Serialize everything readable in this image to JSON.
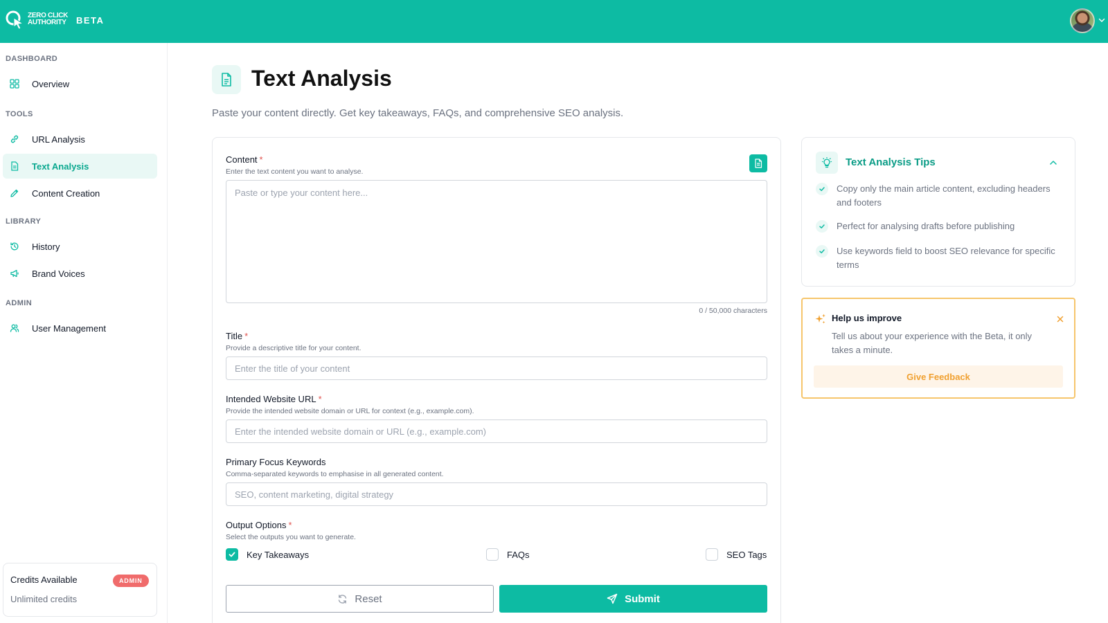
{
  "header": {
    "logo_text_line1": "ZERO CLICK",
    "logo_text_line2": "AUTHORITY",
    "beta_label": "BETA",
    "brand_color": "#0dbba3"
  },
  "sidebar": {
    "sections": {
      "dashboard": "DASHBOARD",
      "tools": "TOOLS",
      "library": "LIBRARY",
      "admin": "ADMIN"
    },
    "items": {
      "overview": "Overview",
      "url_analysis": "URL Analysis",
      "text_analysis": "Text Analysis",
      "content_creation": "Content Creation",
      "history": "History",
      "brand_voices": "Brand Voices",
      "user_management": "User Management"
    },
    "active_item": "Text Analysis",
    "credits": {
      "title": "Credits Available",
      "badge": "ADMIN",
      "subtitle": "Unlimited credits"
    }
  },
  "page": {
    "title": "Text Analysis",
    "subtitle": "Paste your content directly. Get key takeaways, FAQs, and comprehensive SEO analysis."
  },
  "form": {
    "content": {
      "label": "Content",
      "required_mark": "*",
      "help": "Enter the text content you want to analyse.",
      "placeholder": "Paste or type your content here...",
      "value": "",
      "char_count": "0 / 50,000 characters"
    },
    "title": {
      "label": "Title",
      "required_mark": "*",
      "help": "Provide a descriptive title for your content.",
      "placeholder": "Enter the title of your content",
      "value": ""
    },
    "website_url": {
      "label": "Intended Website URL",
      "required_mark": "*",
      "help": "Provide the intended website domain or URL for context (e.g., example.com).",
      "placeholder": "Enter the intended website domain or URL (e.g., example.com)",
      "value": ""
    },
    "keywords": {
      "label": "Primary Focus Keywords",
      "help": "Comma-separated keywords to emphasise in all generated content.",
      "placeholder": "SEO, content marketing, digital strategy",
      "value": ""
    },
    "output_options": {
      "label": "Output Options",
      "required_mark": "*",
      "help": "Select the outputs you want to generate.",
      "options": [
        {
          "label": "Key Takeaways",
          "checked": true
        },
        {
          "label": "FAQs",
          "checked": false
        },
        {
          "label": "SEO Tags",
          "checked": false
        }
      ]
    },
    "reset_label": "Reset",
    "submit_label": "Submit"
  },
  "tips": {
    "title": "Text Analysis Tips",
    "items": [
      "Copy only the main article content, excluding headers and footers",
      "Perfect for analysing drafts before publishing",
      "Use keywords field to boost SEO relevance for specific terms"
    ]
  },
  "feedback": {
    "title": "Help us improve",
    "text": "Tell us about your experience with the Beta, it only takes a minute.",
    "button": "Give Feedback",
    "accent_color": "#f6c56b"
  }
}
